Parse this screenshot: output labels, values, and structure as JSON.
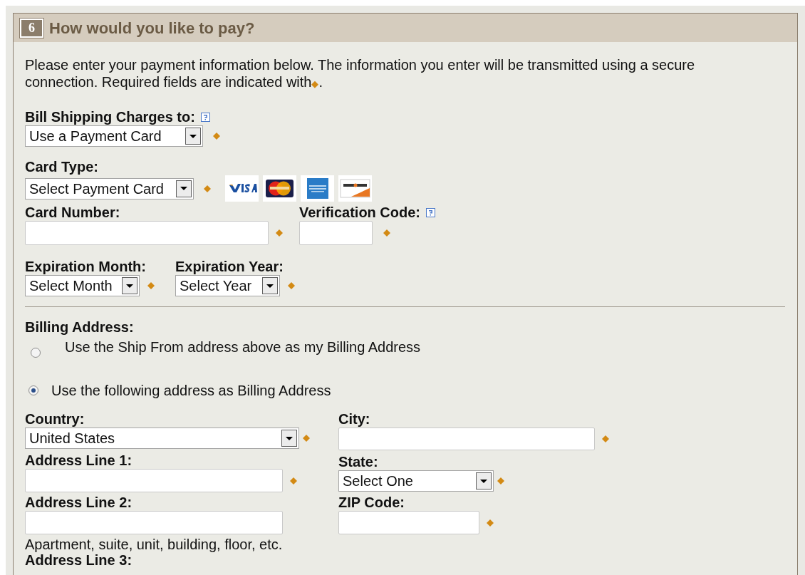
{
  "section": {
    "number": "6",
    "title": "How would you like to pay?"
  },
  "intro": {
    "text": "Please enter your payment information below. The information you enter will be transmitted using a secure connection. Required fields are indicated with",
    "marker": "◆",
    "end": "."
  },
  "bill_to": {
    "label": "Bill Shipping Charges to:",
    "help": true,
    "value": "Use a Payment Card",
    "required": true
  },
  "card_type": {
    "label": "Card Type:",
    "value": "Select Payment Card",
    "required": true,
    "logos": [
      {
        "kind": "visa"
      },
      {
        "kind": "mastercard"
      },
      {
        "kind": "amex"
      },
      {
        "kind": "discover"
      }
    ]
  },
  "card_number": {
    "label": "Card Number:",
    "required": true
  },
  "verification_code": {
    "label": "Verification Code:",
    "help": true,
    "required": true
  },
  "expiration_month": {
    "label": "Expiration Month:",
    "value": "Select Month",
    "required": true
  },
  "expiration_year": {
    "label": "Expiration Year:",
    "value": "Select Year",
    "required": true
  },
  "billing_address": {
    "label": "Billing Address:",
    "options": [
      {
        "label": "Use the Ship From address above as my Billing Address",
        "selected": false
      },
      {
        "label": "Use the following address as Billing Address",
        "selected": true
      }
    ]
  },
  "country": {
    "label": "Country:",
    "value": "United States",
    "required": true
  },
  "city": {
    "label": "City:",
    "required": true
  },
  "address_line_1": {
    "label": "Address Line 1:",
    "required": true
  },
  "state": {
    "label": "State:",
    "value": "Select One",
    "required": true
  },
  "address_line_2": {
    "label": "Address Line 2:",
    "required": false,
    "hint": "Apartment, suite, unit, building, floor, etc."
  },
  "zip_code": {
    "label": "ZIP Code:",
    "required": true
  },
  "address_line_3": {
    "label": "Address Line 3:"
  }
}
